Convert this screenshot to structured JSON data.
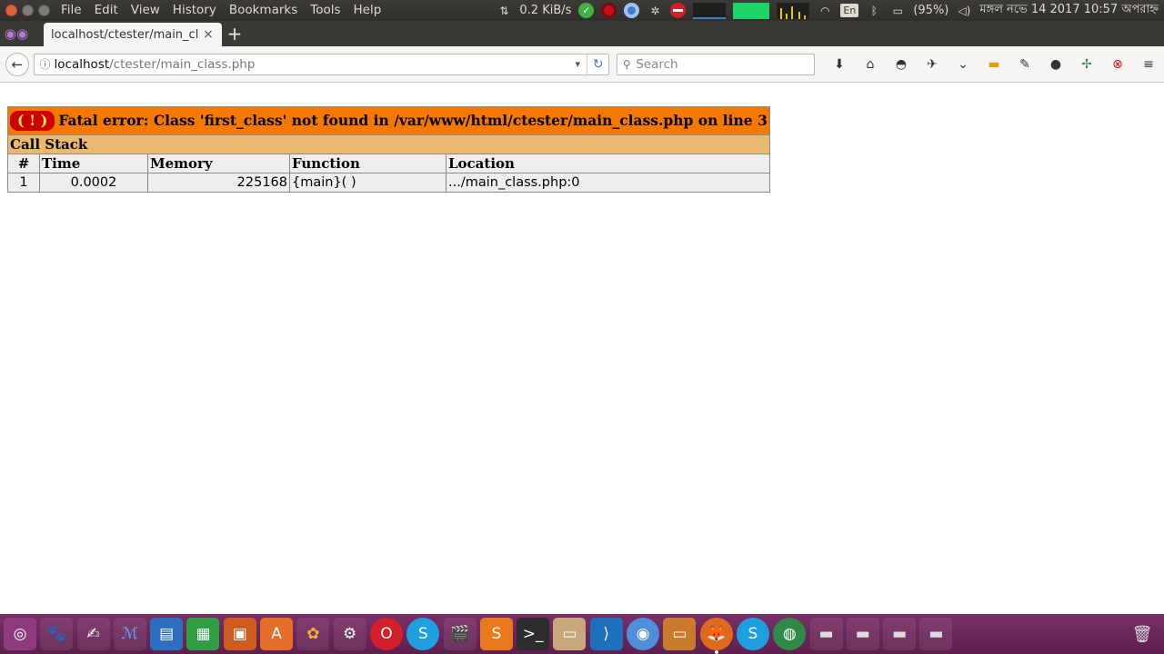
{
  "menubar": {
    "items": [
      "File",
      "Edit",
      "View",
      "History",
      "Bookmarks",
      "Tools",
      "Help"
    ]
  },
  "tray": {
    "net_speed": "0.2 KiB/s",
    "language": "En",
    "battery": "(95%)",
    "datetime": "মঙ্গল নভে 14 2017 10:57 অপরাহ্ন"
  },
  "tab": {
    "title": "localhost/ctester/main_cl",
    "close_glyph": "×",
    "new_tab_glyph": "+"
  },
  "urlbar": {
    "host": "localhost",
    "path": "/ctester/main_class.php"
  },
  "searchbar": {
    "placeholder": "Search"
  },
  "error": {
    "bang": "( ! )",
    "message": "Fatal error: Class 'first_class' not found in /var/www/html/ctester/main_class.php on line 3",
    "call_stack_label": "Call Stack",
    "columns": [
      "#",
      "Time",
      "Memory",
      "Function",
      "Location"
    ],
    "rows": [
      {
        "num": "1",
        "time": "0.0002",
        "memory": "225168",
        "function": "{main}( )",
        "location": ".../main_class.php:0"
      }
    ]
  },
  "launcher": {
    "apps": [
      "dash-icon",
      "gimp-icon",
      "text-editor-icon",
      "matlab-icon",
      "writer-icon",
      "calc-icon",
      "impress-icon",
      "software-center-icon",
      "photos-icon",
      "tweak-tool-icon",
      "opera-icon",
      "skype-icon",
      "video-editor-icon",
      "sublime-icon",
      "terminal-icon",
      "archive-icon",
      "vscode-icon",
      "chromium-icon",
      "app-icon",
      "firefox-icon",
      "skype-beta-icon",
      "globe-icon",
      "drive-icon",
      "drive-icon",
      "drive-icon",
      "drive-icon"
    ],
    "trash": "trash-icon"
  }
}
